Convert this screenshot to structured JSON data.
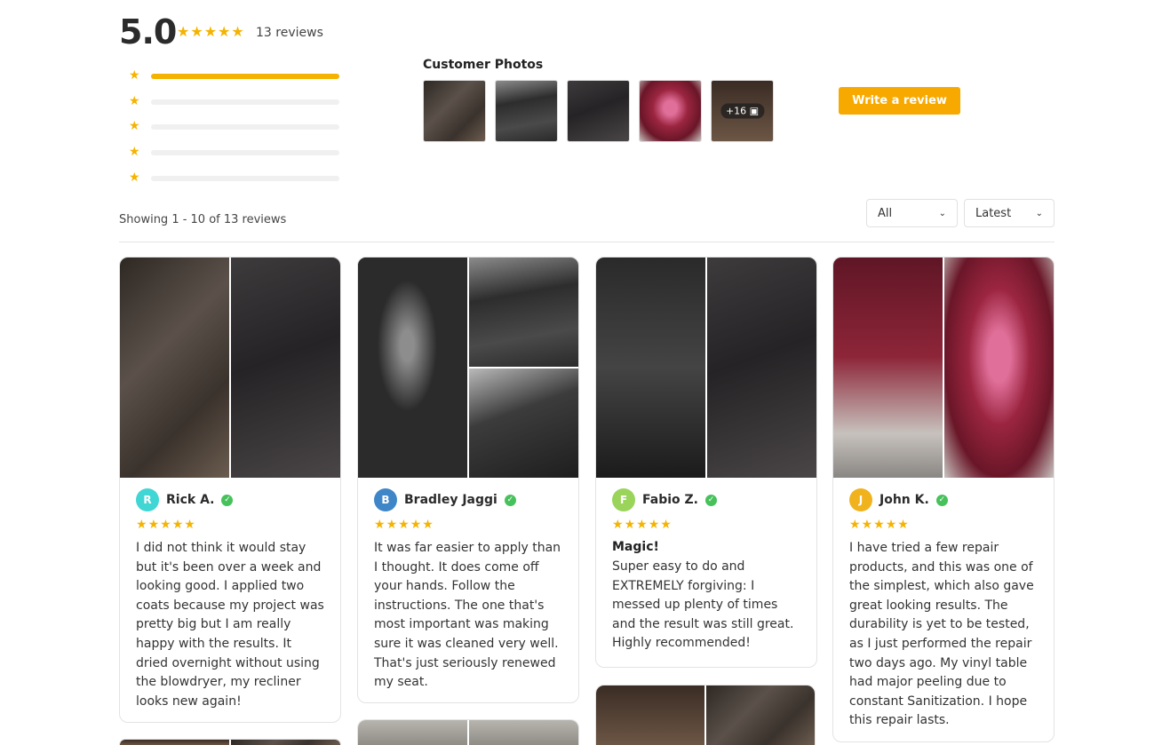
{
  "summary": {
    "score": "5.0",
    "review_count": "13 reviews",
    "stars": 5,
    "distribution": [
      {
        "stars": 5,
        "fraction": 1.0
      },
      {
        "stars": 4,
        "fraction": 0.0
      },
      {
        "stars": 3,
        "fraction": 0.0
      },
      {
        "stars": 2,
        "fraction": 0.0
      },
      {
        "stars": 1,
        "fraction": 0.0
      }
    ]
  },
  "photos": {
    "title": "Customer Photos",
    "more_label": "+16",
    "thumbnails": [
      "leather-closeup",
      "car-seat",
      "dark-leather",
      "red-vinyl",
      "more-photos"
    ]
  },
  "actions": {
    "write_review": "Write a review"
  },
  "list": {
    "showing": "Showing 1 - 10 of 13 reviews",
    "filter_value": "All",
    "sort_value": "Latest"
  },
  "colors": {
    "accent": "#f7a900",
    "star": "#f5b301",
    "verified": "#47c15b"
  },
  "reviews": [
    {
      "author": "Rick A.",
      "initial": "R",
      "avatar_color": "#3fd6d3",
      "rating": 5,
      "title": "",
      "body": "I did not think it would stay but it's been over a week and looking good. I applied two coats because my project was pretty big but I am really happy with the results. It dried overnight without using the blowdryer, my recliner looks new again!"
    },
    {
      "author": "Bradley Jaggi",
      "initial": "B",
      "avatar_color": "#3f86c8",
      "rating": 5,
      "title": "",
      "body": "It was far easier to apply than I thought. It does come off your hands. Follow the instructions. The one that's most important was making sure it was cleaned very well. That's just seriously renewed my seat."
    },
    {
      "author": "Fabio Z.",
      "initial": "F",
      "avatar_color": "#9ad45b",
      "rating": 5,
      "title": "Magic!",
      "body": "Super easy to do and EXTREMELY forgiving: I messed up plenty of times and the result was still great. Highly recommended!"
    },
    {
      "author": "John K.",
      "initial": "J",
      "avatar_color": "#f0b21d",
      "rating": 5,
      "title": "",
      "body": "I have tried a few repair products, and this was one of the simplest, which also gave great looking results. The durability is yet to be tested, as I just performed the repair two days ago. My vinyl table had major peeling due to constant Sanitization. I hope this repair lasts."
    }
  ]
}
